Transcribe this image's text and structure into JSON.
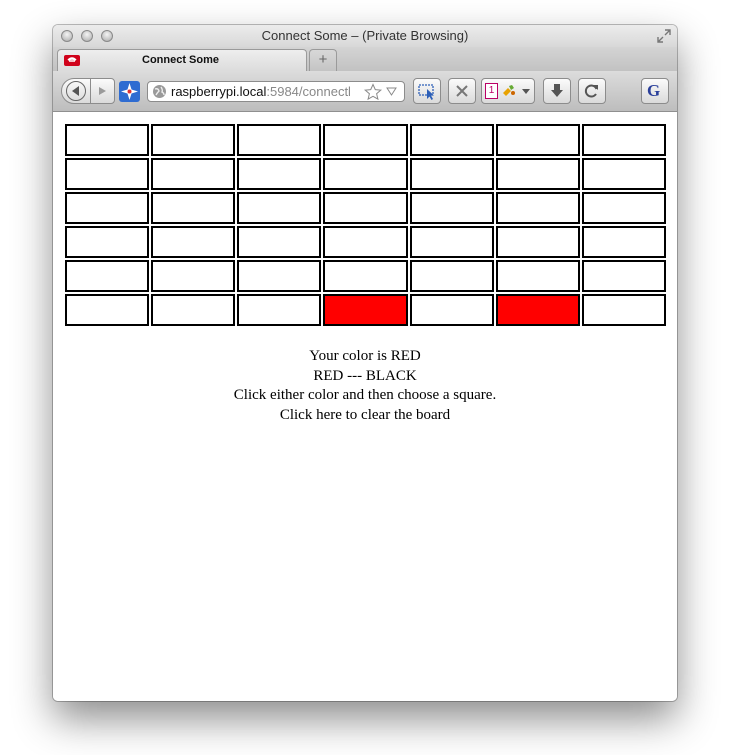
{
  "window": {
    "title": "Connect Some – (Private Browsing)"
  },
  "tabs": [
    {
      "label": "Connect Some",
      "icon": "private-browsing-icon"
    }
  ],
  "newtab_label": "+",
  "toolbar": {
    "url_host": "raspberrypi.local",
    "url_path": ":5984/connectl",
    "icons": [
      "back-icon",
      "forward-icon",
      "compass-icon",
      "globe-icon",
      "bookmark-star-icon",
      "dropdown-icon",
      "select-element-icon",
      "stop-icon",
      "calendar-icon",
      "extension-icon",
      "download-icon",
      "reload-icon",
      "translate-icon"
    ],
    "translate_label": "G",
    "calendar_label": "1"
  },
  "board": {
    "rows": 6,
    "cols": 7,
    "colors": {
      "empty": "#ffffff",
      "red": "#ff0000",
      "black": "#000000"
    },
    "cells": [
      [
        "empty",
        "empty",
        "empty",
        "empty",
        "empty",
        "empty",
        "empty"
      ],
      [
        "empty",
        "empty",
        "empty",
        "empty",
        "empty",
        "empty",
        "empty"
      ],
      [
        "empty",
        "empty",
        "empty",
        "empty",
        "empty",
        "empty",
        "empty"
      ],
      [
        "empty",
        "empty",
        "empty",
        "empty",
        "empty",
        "empty",
        "empty"
      ],
      [
        "empty",
        "empty",
        "empty",
        "empty",
        "empty",
        "empty",
        "empty"
      ],
      [
        "empty",
        "empty",
        "empty",
        "red",
        "empty",
        "red",
        "empty"
      ]
    ]
  },
  "info": {
    "your_color": "Your color is RED",
    "color_choice": "RED --- BLACK",
    "instructions": "Click either color and then choose a square.",
    "clear_board": "Click here to clear the board"
  }
}
